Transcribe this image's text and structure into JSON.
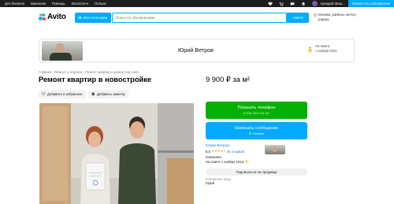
{
  "topbar": {
    "nav": [
      "Для бизнеса",
      "Вакансии",
      "Помощь",
      "Каталоги ▾",
      "Польза"
    ],
    "user_name": "Аркадий Шиш...",
    "post_button": "Разместить объявление"
  },
  "header": {
    "logo_text": "Avito",
    "categories_button": "Все категории",
    "search_placeholder": "Поиск по объявлениям",
    "find_button": "Найти",
    "location": "Москва, районы, метро, радиус"
  },
  "banner": {
    "seller_name": "Юрий Ветров",
    "since_line1": "На Авито",
    "since_line2": "с ноября 2015"
  },
  "breadcrumb": "Главная  ·  Ремонт и отделка  ·  Ремонт квартир и домов под ключ",
  "listing": {
    "title": "Ремонт квартир в новостройке",
    "price": "9 900 ₽ за м²",
    "favorite_label": "Добавить в избранное",
    "note_label": "Добавить заметку"
  },
  "actions": {
    "phone_label": "Показать телефон",
    "phone_masked": "8 915 XXX-XX-XX",
    "message_label": "Написать сообщение",
    "online_status": "Онлайн"
  },
  "seller": {
    "name": "Юрий Ветров",
    "rating": "5,0",
    "stars": "★★★★★",
    "reviews": "45 отзывов",
    "kind": "Компания",
    "since": "На Авито с ноября 2015",
    "subscribe_label": "Подписаться на продавца",
    "contact_label": "Контактное лицо",
    "contact_value": "Юрий"
  },
  "colors": {
    "accent": "#00aaff",
    "phone_green": "#04b004",
    "topbar": "#1d1d1d"
  }
}
